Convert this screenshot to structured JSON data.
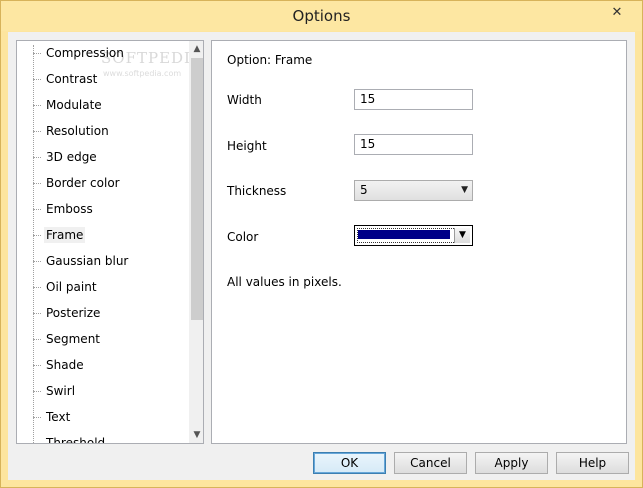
{
  "window": {
    "title": "Options",
    "close_glyph": "✕"
  },
  "tree": {
    "items": [
      {
        "label": "Compression"
      },
      {
        "label": "Contrast"
      },
      {
        "label": "Modulate"
      },
      {
        "label": "Resolution"
      },
      {
        "label": "3D edge"
      },
      {
        "label": "Border color"
      },
      {
        "label": "Emboss"
      },
      {
        "label": "Frame"
      },
      {
        "label": "Gaussian blur"
      },
      {
        "label": "Oil paint"
      },
      {
        "label": "Posterize"
      },
      {
        "label": "Segment"
      },
      {
        "label": "Shade"
      },
      {
        "label": "Swirl"
      },
      {
        "label": "Text"
      },
      {
        "label": "Threshold"
      }
    ],
    "selected_index": 7,
    "watermark": "SOFTPEDIA",
    "watermark_sub": "www.softpedia.com"
  },
  "panel": {
    "heading": "Option: Frame",
    "width_label": "Width",
    "width_value": "15",
    "height_label": "Height",
    "height_value": "15",
    "thickness_label": "Thickness",
    "thickness_value": "5",
    "color_label": "Color",
    "color_value": "#000088",
    "note": "All values in pixels."
  },
  "buttons": {
    "ok": "OK",
    "cancel": "Cancel",
    "apply": "Apply",
    "help": "Help"
  },
  "icons": {
    "scroll_up": "▲",
    "scroll_down": "▼",
    "dropdown": "▼"
  }
}
